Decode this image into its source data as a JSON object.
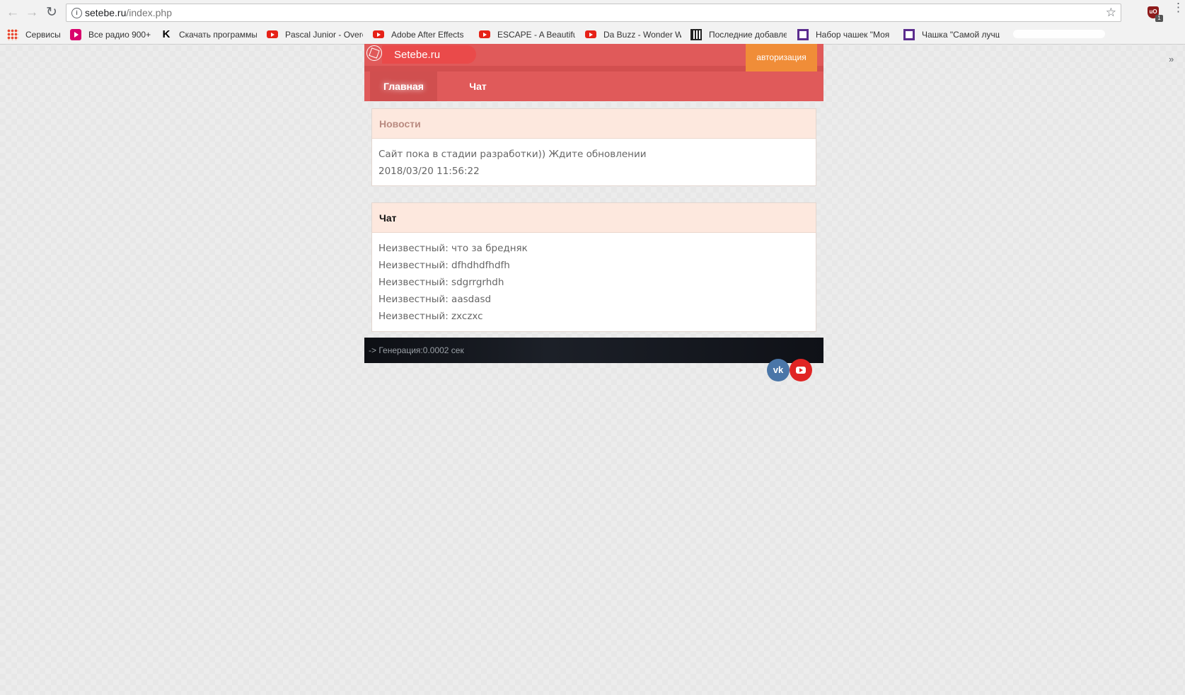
{
  "browser": {
    "url_host": "setebe.ru",
    "url_path": "/index.php",
    "bookmarks": [
      {
        "label": "Сервисы",
        "icon": "apps-icon"
      },
      {
        "label": "Все радио 900+",
        "icon": "radio-icon"
      },
      {
        "label": "Скачать программы",
        "icon": "k-icon"
      },
      {
        "label": "Pascal Junior - Overc",
        "icon": "youtube-icon"
      },
      {
        "label": "Adobe After Effects",
        "icon": "youtube-icon"
      },
      {
        "label": "ESCAPE - A Beautiful",
        "icon": "youtube-icon"
      },
      {
        "label": "Da Buzz - Wonder W",
        "icon": "youtube-icon"
      },
      {
        "label": "Последние добавле",
        "icon": "film-icon"
      },
      {
        "label": "Набор чашек \"Моя",
        "icon": "cup-icon"
      },
      {
        "label": "Чашка \"Самой лучш",
        "icon": "cup-icon"
      }
    ],
    "extension_badge": "1"
  },
  "site": {
    "logo_text": "Setebe.ru",
    "auth_label": "авторизация",
    "nav": [
      {
        "label": "Главная",
        "active": true
      },
      {
        "label": "Чат",
        "active": false
      }
    ],
    "news": {
      "title": "Новости",
      "title_color": "#b98a80",
      "text": "Сайт пока в стадии разработки)) Ждите обновлении",
      "date": "2018/03/20 11:56:22"
    },
    "chat": {
      "title": "Чат",
      "title_color": "#111111",
      "messages": [
        "Неизвестный: что за бредняк",
        "Неизвестный: dfhdhdfhdfh",
        "Неизвестный: sdgrrgrhdh",
        "Неизвестный: aasdasd",
        "Неизвестный: zxczxc"
      ]
    },
    "footer_text": "-> Генерация:0.0002 сек",
    "social": [
      {
        "label": "VK",
        "icon": "vk-icon",
        "color": "#4a76a8"
      },
      {
        "label": "YouTube",
        "icon": "youtube-icon",
        "color": "#e02424"
      }
    ],
    "colors": {
      "header": "#e05a5a",
      "auth": "#f08d38",
      "panel_head": "#fde8de"
    }
  }
}
